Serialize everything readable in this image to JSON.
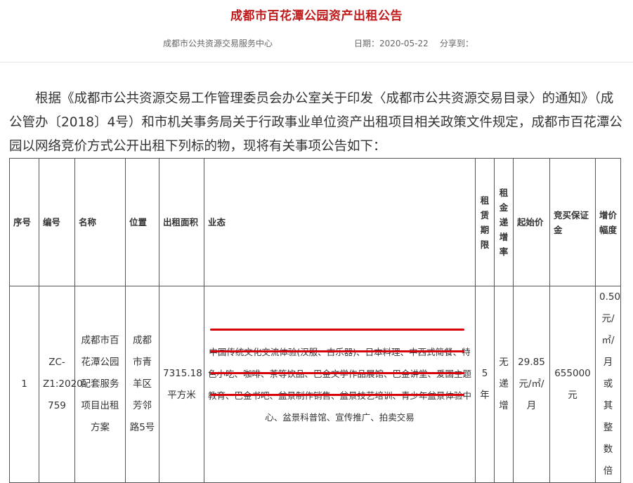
{
  "header": {
    "title": "成都市百花潭公园资产出租公告",
    "source": "成都市公共资源交易服务中心",
    "date": "日期：2020-05-22",
    "share": "分享到："
  },
  "intro": "根据《成都市公共资源交易工作管理委员会办公室关于印发〈成都市公共资源交易目录〉的通知》（成公管办〔2018〕4号）和市机关事务局关于行政事业单位资产出租项目相关政策文件规定，成都市百花潭公园以网络竞价方式公开出租下列标的物，现将有关事项公告如下：",
  "table": {
    "headers": {
      "seq": "序号",
      "code": "编号",
      "name": "名称",
      "location": "位置",
      "area": "出租面积",
      "business": "业态",
      "term": "租赁期限",
      "rent_increase": "租金递增率",
      "start_price": "起始价",
      "deposit": "竞买保证金",
      "increment": "增价幅度"
    },
    "rows": [
      {
        "seq": "1",
        "code": "ZC-Z1:2020-759",
        "name": "成都市百花潭公园配套服务项目出租方案",
        "location": "成都市青羊区芳邻路5号",
        "area": "7315.18平方米",
        "business": "中国传统文化交流体验(汉服、古乐器)、日本料理、中西式简餐、特色小吃、咖啡、茶等饮品、巴金文学作品展馆、巴金讲堂、爱国主题教育、巴金书吧、盆景制作销售、盆景技艺培训、青少年盆景体验中心、盆景科普馆、宣传推广、拍卖交易",
        "term": "5年",
        "rent_increase": "无递增",
        "start_price": "29.85元/㎡/月",
        "deposit": "655000元",
        "increment": "0.50元/㎡/月或其整数倍"
      }
    ]
  },
  "colors": {
    "title": "#c0191a",
    "highlight_underline": "#d9000d"
  }
}
